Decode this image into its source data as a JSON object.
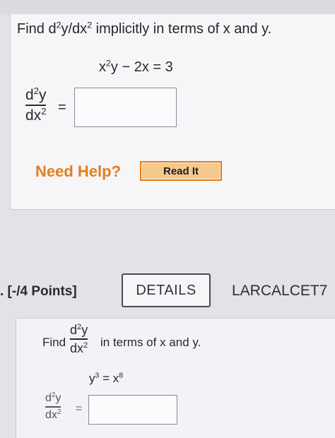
{
  "question1": {
    "prompt_prefix": "Find d",
    "prompt_exp1": "2",
    "prompt_mid": "y/dx",
    "prompt_exp2": "2",
    "prompt_suffix": " implicitly in terms of x and y.",
    "equation_a": "x",
    "equation_exp": "2",
    "equation_b": "y − 2x = 3",
    "lhs_num": "d",
    "lhs_num_exp": "2",
    "lhs_num_tail": "y",
    "lhs_den": "dx",
    "lhs_den_exp": "2",
    "equals": "=",
    "answer_value": "",
    "need_help": "Need Help?",
    "read_it": "Read It"
  },
  "question2_header": {
    "points": ". [-/4 Points]",
    "details": "DETAILS",
    "course_code": "LARCALCET7"
  },
  "question2": {
    "find": "Find",
    "frac_num": "d",
    "frac_num_exp": "2",
    "frac_num_tail": "y",
    "frac_den": "dx",
    "frac_den_exp": "2",
    "tail": "in terms of x and y.",
    "eq_a": "y",
    "eq_a_exp": "3",
    "eq_mid": " = x",
    "eq_b_exp": "8",
    "lhs_num": "d",
    "lhs_num_exp": "2",
    "lhs_num_tail": "y",
    "lhs_den": "dx",
    "lhs_den_exp": "2",
    "equals": "=",
    "answer_value": ""
  }
}
